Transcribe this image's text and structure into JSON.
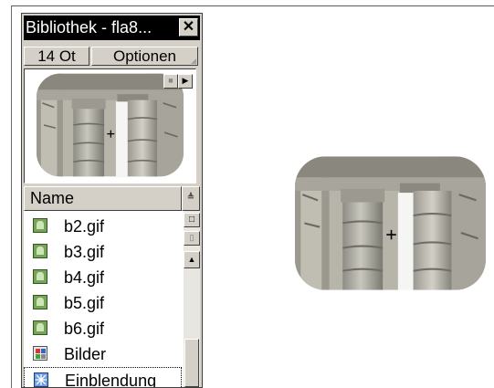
{
  "library": {
    "title": "Bibliothek - fla8...",
    "close_label": "✕",
    "item_count": "14 Ot",
    "options_label": "Optionen",
    "preview": {
      "stop_icon": "stop-icon",
      "play_icon": "play-icon",
      "stop_glyph": "■",
      "play_glyph": "▶"
    },
    "list": {
      "header": "Name",
      "sort_glyph": "≜",
      "items": [
        {
          "label": "b2.gif",
          "icon": "bitmap-icon"
        },
        {
          "label": "b3.gif",
          "icon": "bitmap-icon"
        },
        {
          "label": "b4.gif",
          "icon": "bitmap-icon"
        },
        {
          "label": "b5.gif",
          "icon": "bitmap-icon"
        },
        {
          "label": "b6.gif",
          "icon": "bitmap-icon"
        },
        {
          "label": "Bilder",
          "icon": "graphic-symbol-icon"
        },
        {
          "label": "Einblendung",
          "icon": "movie-clip-icon"
        }
      ],
      "selected_index": 6
    },
    "scrollbar": {
      "wide_view_glyph": "□",
      "narrow_view_glyph": "▯",
      "up_glyph": "▲"
    }
  },
  "stage": {
    "image": "temple-columns-photo",
    "crosshair_glyph": "+"
  }
}
